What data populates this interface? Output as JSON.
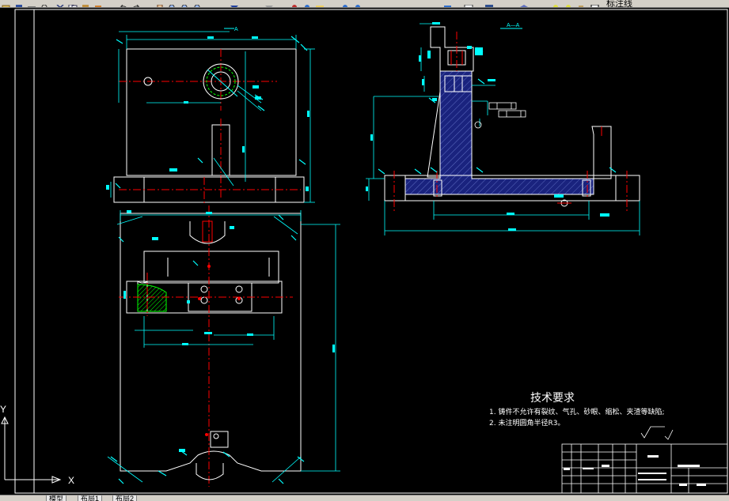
{
  "toolbar": {
    "layer_name": "标注线",
    "icons": [
      "open-icon",
      "save-icon",
      "print-icon",
      "preview-icon",
      "cut-icon",
      "copy-icon",
      "paste-icon",
      "match-icon",
      "undo-icon",
      "redo-icon",
      "pan-icon",
      "zoom-realtime-icon",
      "zoom-window-icon",
      "zoom-previous-icon",
      "properties-icon",
      "design-center-icon",
      "tool-palette-icon",
      "help-icon",
      "layer-manager-icon",
      "layer-state-icon",
      "layer-color-icon"
    ]
  },
  "tabs": [
    {
      "label": "模型"
    },
    {
      "label": "布局1"
    },
    {
      "label": "布局2"
    }
  ],
  "ucs": {
    "x_label": "X",
    "y_label": "Y"
  },
  "section_label": "A—A",
  "view_label": "A",
  "tech_requirements": {
    "title": "技术要求",
    "lines": [
      "1. 铸件不允许有裂纹、气孔、砂眼、缩松、夹渣等缺陷;",
      "2. 未注明圆角半径R3。"
    ]
  },
  "colors": {
    "background": "#000000",
    "outline": "#ffffff",
    "dimension": "#00ffff",
    "centerline": "#ff0000",
    "hatch": "#00ff00",
    "section_fill": "#1a237e",
    "highlight": "#ffff00"
  }
}
